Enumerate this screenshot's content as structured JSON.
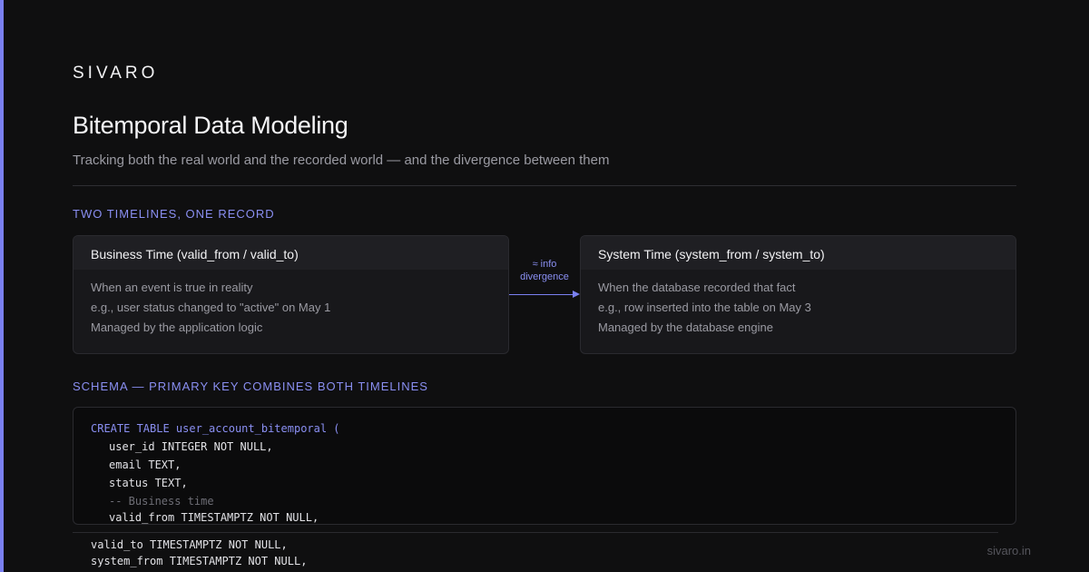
{
  "brand": "SIVARO",
  "title": "Bitemporal Data Modeling",
  "subtitle": "Tracking both the real world and the recorded world — and the divergence between them",
  "section1": "TWO TIMELINES, ONE RECORD",
  "business_card": {
    "title": "Business Time (valid_from / valid_to)",
    "lines": [
      "When an event is true in reality",
      "e.g., user status changed to \"active\" on May 1",
      "Managed by the application logic"
    ]
  },
  "connector": {
    "line1": "≈ info",
    "line2": "divergence"
  },
  "system_card": {
    "title": "System Time (system_from / system_to)",
    "lines": [
      "When the database recorded that fact",
      "e.g., row inserted into the table on May 3",
      "Managed by the database engine"
    ]
  },
  "section2": "SCHEMA — PRIMARY KEY COMBINES BOTH TIMELINES",
  "code": [
    "CREATE TABLE user_account_bitemporal (",
    "user_id INTEGER NOT NULL,",
    "email TEXT,",
    "status TEXT,",
    "-- Business time",
    "valid_from TIMESTAMPTZ NOT NULL,"
  ],
  "overflow_code": [
    "valid_to TIMESTAMPTZ NOT NULL,",
    "system_from TIMESTAMPTZ NOT NULL,"
  ],
  "footer_url": "sivaro.in",
  "colors": {
    "accent": "#7a80f0",
    "background": "#0f0f10",
    "card": "#18181b"
  }
}
